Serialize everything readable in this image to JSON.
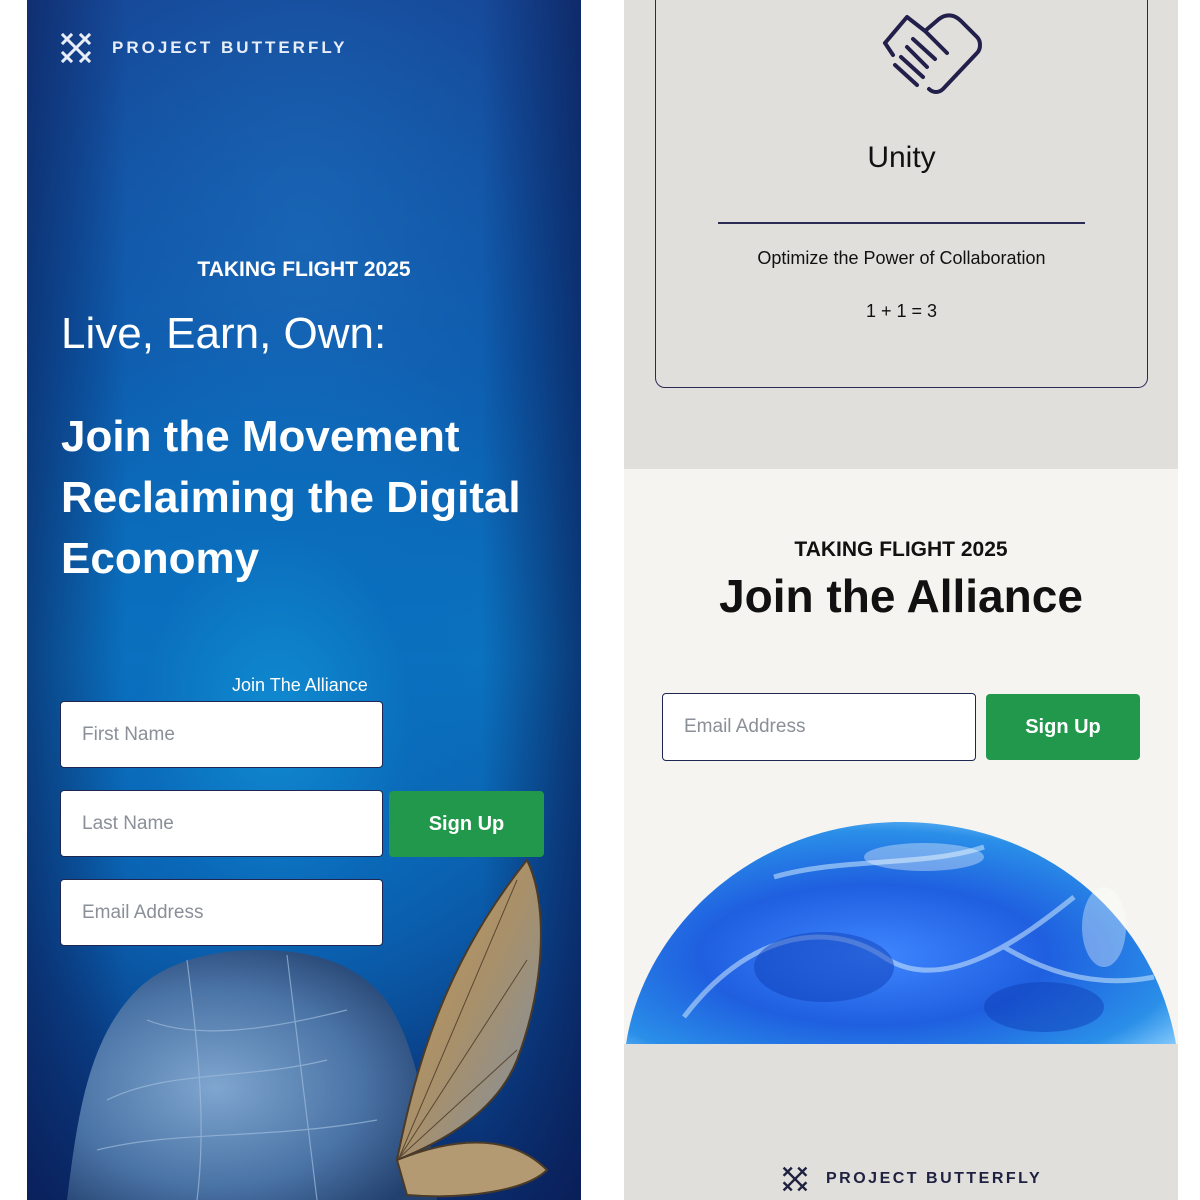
{
  "left_panel": {
    "brand": {
      "name": "PROJECT BUTTERFLY",
      "icon": "project-butterfly-logo-icon"
    },
    "eyebrow": "TAKING FLIGHT 2025",
    "headline": "Live, Earn, Own:",
    "subheadline": "Join the Movement Reclaiming the Digital Economy",
    "form": {
      "label": "Join The Alliance",
      "first_name_placeholder": "First Name",
      "last_name_placeholder": "Last Name",
      "email_placeholder": "Email Address",
      "submit_label": "Sign Up"
    },
    "image": "butterfly-on-wrapped-figure"
  },
  "right_panel": {
    "card": {
      "icon": "handshake-icon",
      "title": "Unity",
      "subtitle": "Optimize the Power of Collaboration",
      "equation": "1 + 1 = 3"
    },
    "alliance": {
      "eyebrow": "TAKING FLIGHT 2025",
      "headline": "Join the Alliance",
      "email_placeholder": "Email Address",
      "submit_label": "Sign Up",
      "image": "blue-glass-globe"
    },
    "footer": {
      "brand_name": "PROJECT BUTTERFLY",
      "icon": "project-butterfly-logo-icon"
    }
  },
  "colors": {
    "accent_green": "#22984c",
    "deep_blue": "#0d5cae",
    "navy": "#1e2140",
    "panel_gray": "#e0dfdb",
    "off_white": "#f5f4f0"
  }
}
